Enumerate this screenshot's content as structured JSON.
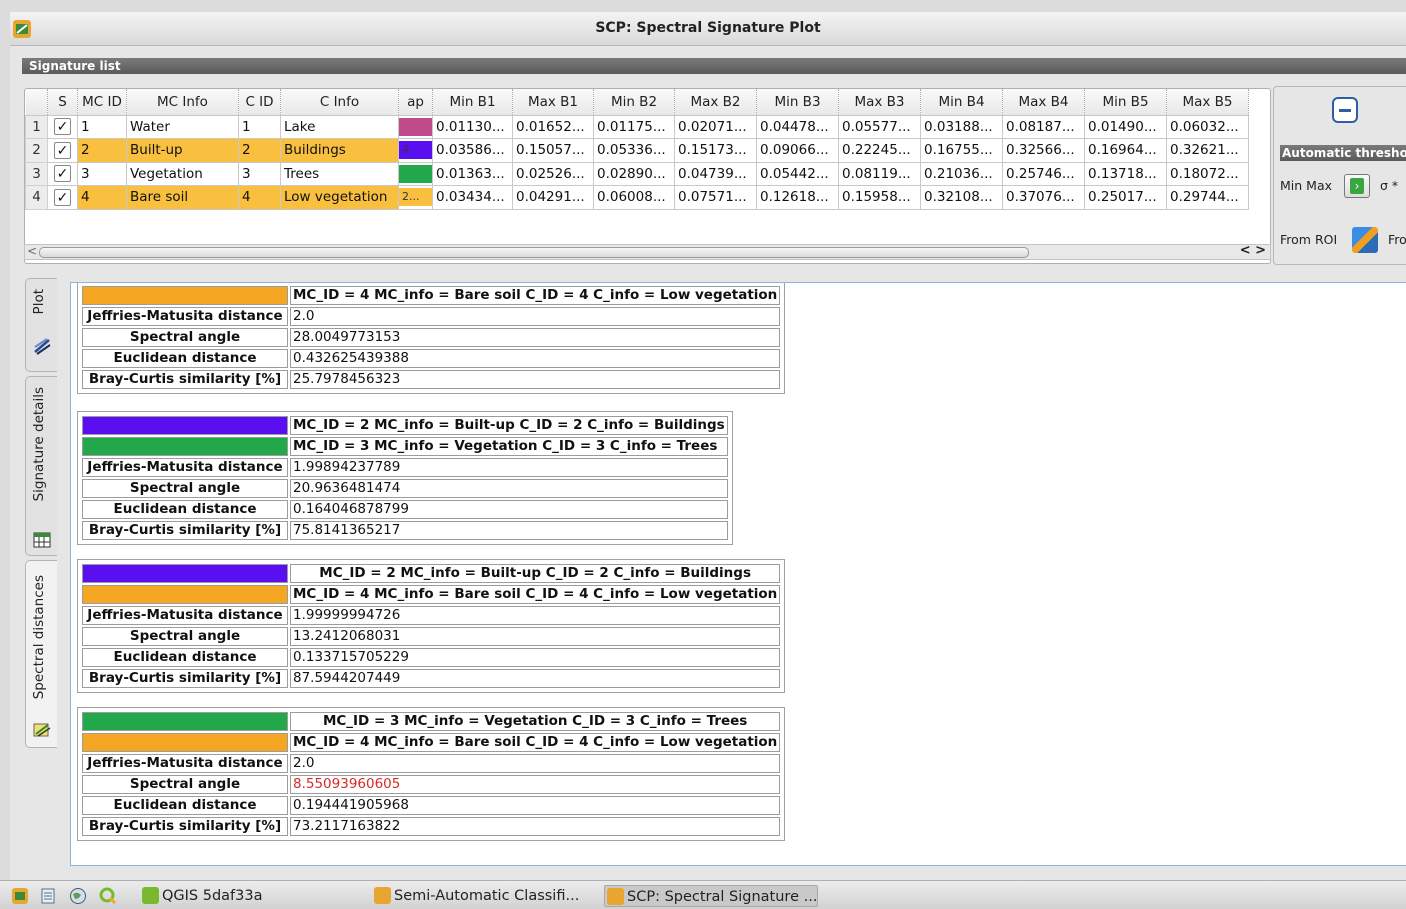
{
  "window": {
    "title": "SCP: Spectral Signature Plot"
  },
  "signature_list": {
    "header": "Signature list",
    "columns": [
      "S",
      "MC ID",
      "MC Info",
      "C ID",
      "C Info",
      "Color",
      "Min B1",
      "Max B1",
      "Min B2",
      "Max B2",
      "Min B3",
      "Max B3",
      "Min B4",
      "Max B4",
      "Min B5",
      "Max B5"
    ],
    "column_display": [
      "S",
      "MC ID",
      "MC Info",
      "C ID",
      "C Info",
      "ap",
      "Min B1",
      "Max B1",
      "Min B2",
      "Max B2",
      "Min B3",
      "Max B3",
      "Min B4",
      "Max B4",
      "Min B5",
      "Max B5"
    ],
    "rows": [
      {
        "num": "1",
        "checked": true,
        "selected": false,
        "mc_id": "1",
        "mc_info": "Water",
        "c_id": "1",
        "c_info": "Lake",
        "color": "#c04a8c",
        "color_text": "",
        "values": [
          "0.01130...",
          "0.01652...",
          "0.01175...",
          "0.02071...",
          "0.04478...",
          "0.05577...",
          "0.03188...",
          "0.08187...",
          "0.01490...",
          "0.06032..."
        ]
      },
      {
        "num": "2",
        "checked": true,
        "selected": true,
        "mc_id": "2",
        "mc_info": "Built-up",
        "c_id": "2",
        "c_info": "Buildings",
        "color": "#5a0ff0",
        "color_text": "4",
        "values": [
          "0.03586...",
          "0.15057...",
          "0.05336...",
          "0.15173...",
          "0.09066...",
          "0.22245...",
          "0.16755...",
          "0.32566...",
          "0.16964...",
          "0.32621..."
        ]
      },
      {
        "num": "3",
        "checked": true,
        "selected": false,
        "mc_id": "3",
        "mc_info": "Vegetation",
        "c_id": "3",
        "c_info": "Trees",
        "color": "#22a84a",
        "color_text": "",
        "values": [
          "0.01363...",
          "0.02526...",
          "0.02890...",
          "0.04739...",
          "0.05442...",
          "0.08119...",
          "0.21036...",
          "0.25746...",
          "0.13718...",
          "0.18072..."
        ]
      },
      {
        "num": "4",
        "checked": true,
        "selected": true,
        "mc_id": "4",
        "mc_info": "Bare soil",
        "c_id": "4",
        "c_info": "Low vegetation",
        "color": "#f5a623",
        "color_text": "2...",
        "values": [
          "0.03434...",
          "0.04291...",
          "0.06008...",
          "0.07571...",
          "0.12618...",
          "0.15958...",
          "0.32108...",
          "0.37076...",
          "0.25017...",
          "0.29744..."
        ]
      }
    ]
  },
  "right_panel": {
    "remove_icon": "minus-icon",
    "auto_threshold_label": "Automatic thresho",
    "min_max_label": "Min Max",
    "sigma_label": "σ *",
    "from_roi_label": "From ROI",
    "from_label_cut": "Fro"
  },
  "tabs": [
    {
      "label": "Plot",
      "icon": "plot-icon"
    },
    {
      "label": "Signature details",
      "icon": "table-icon"
    },
    {
      "label": "Spectral distances",
      "icon": "distance-icon"
    }
  ],
  "distances": [
    {
      "partial": true,
      "sig_a": {
        "color": "#f5a623",
        "text": "MC_ID = 4 MC_info = Bare soil C_ID = 4 C_info = Low vegetation"
      },
      "jm": "2.0",
      "sa": "28.0049773153",
      "ed": "0.432625439388",
      "bc": "25.7978456323",
      "sa_red": false
    },
    {
      "sig_a": {
        "color": "#5a0ff0",
        "text": "MC_ID = 2 MC_info = Built-up C_ID = 2 C_info = Buildings"
      },
      "sig_b": {
        "color": "#22a84a",
        "text": "MC_ID = 3 MC_info = Vegetation C_ID = 3 C_info = Trees"
      },
      "jm": "1.99894237789",
      "sa": "20.9636481474",
      "ed": "0.164046878799",
      "bc": "75.8141365217",
      "sa_red": false
    },
    {
      "sig_a": {
        "color": "#5a0ff0",
        "text": "MC_ID = 2 MC_info = Built-up C_ID = 2 C_info = Buildings"
      },
      "sig_b": {
        "color": "#f5a623",
        "text": "MC_ID = 4 MC_info = Bare soil C_ID = 4 C_info = Low vegetation"
      },
      "jm": "1.99999994726",
      "sa": "13.2412068031",
      "ed": "0.133715705229",
      "bc": "87.5944207449",
      "sa_red": false
    },
    {
      "sig_a": {
        "color": "#22a84a",
        "text": "MC_ID = 3 MC_info = Vegetation C_ID = 3 C_info = Trees"
      },
      "sig_b": {
        "color": "#f5a623",
        "text": "MC_ID = 4 MC_info = Bare soil C_ID = 4 C_info = Low vegetation"
      },
      "jm": "2.0",
      "sa": "8.55093960605",
      "ed": "0.194441905968",
      "bc": "73.2117163822",
      "sa_red": true
    }
  ],
  "labels": {
    "jm": "Jeffries-Matusita distance",
    "sa": "Spectral angle",
    "ed": "Euclidean distance",
    "bc": "Bray-Curtis similarity [%]"
  },
  "taskbar": {
    "items": [
      {
        "label": "QGIS 5daf33a",
        "icon": "qgis-icon"
      },
      {
        "label": "Semi-Automatic Classifi...",
        "icon": "scp-icon"
      },
      {
        "label": "SCP: Spectral Signature ...",
        "icon": "scp-icon",
        "active": true
      }
    ],
    "launcher_icons": [
      "scp-launcher-icon",
      "files-icon",
      "globe-icon",
      "qgis-launcher-icon"
    ]
  }
}
